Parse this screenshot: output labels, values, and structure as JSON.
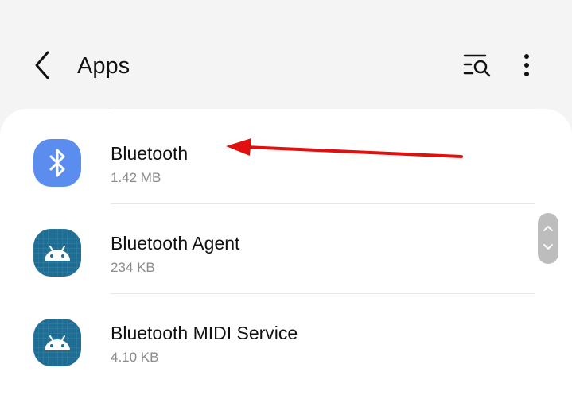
{
  "header": {
    "title": "Apps",
    "back_icon": "chevron-left-icon",
    "search_icon": "list-search-icon",
    "more_icon": "more-vert-icon"
  },
  "apps": [
    {
      "name": "Bluetooth",
      "size": "1.42 MB",
      "icon": "bluetooth-icon"
    },
    {
      "name": "Bluetooth Agent",
      "size": "234 KB",
      "icon": "android-icon"
    },
    {
      "name": "Bluetooth MIDI Service",
      "size": "4.10 KB",
      "icon": "android-icon"
    }
  ],
  "colors": {
    "background": "#f4f4f4",
    "card": "#ffffff",
    "bluetooth_icon_bg": "#5b8def",
    "android_icon_bg": "#1f6d93",
    "annotation_arrow": "#e01010"
  }
}
